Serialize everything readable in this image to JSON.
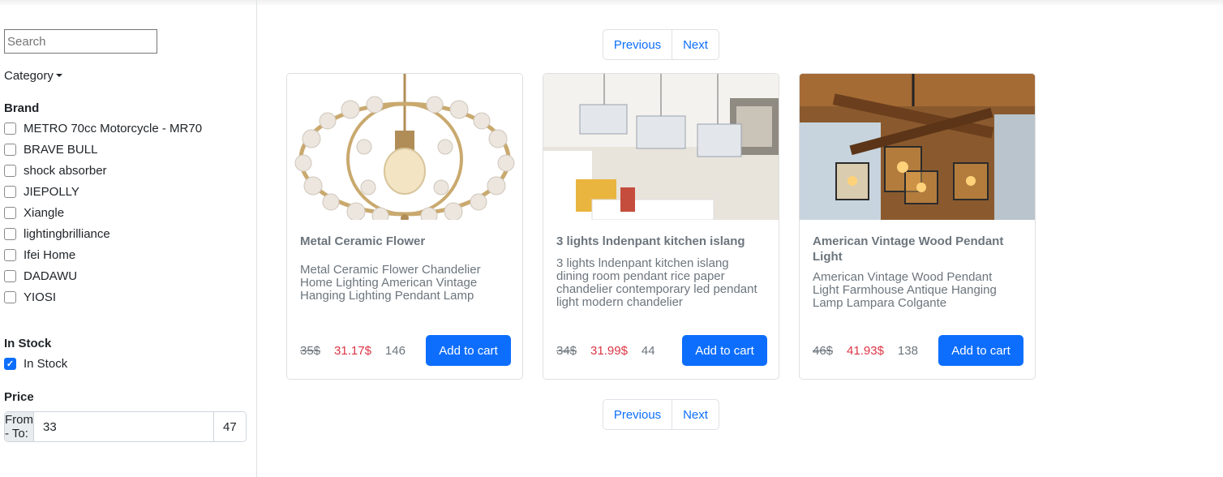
{
  "sidebar": {
    "search_placeholder": "Search",
    "category_label": "Category",
    "brand_title": "Brand",
    "brands": [
      {
        "label": "METRO 70cc Motorcycle - MR70",
        "checked": false
      },
      {
        "label": "BRAVE BULL",
        "checked": false
      },
      {
        "label": "shock absorber",
        "checked": false
      },
      {
        "label": "JIEPOLLY",
        "checked": false
      },
      {
        "label": "Xiangle",
        "checked": false
      },
      {
        "label": "lightingbrilliance",
        "checked": false
      },
      {
        "label": "Ifei Home",
        "checked": false
      },
      {
        "label": "DADAWU",
        "checked": false
      },
      {
        "label": "YIOSI",
        "checked": false
      }
    ],
    "stock_title": "In Stock",
    "stock_option": {
      "label": "In Stock",
      "checked": true
    },
    "price_title": "Price",
    "price_label": "From - To:",
    "price_from": "33",
    "price_to": "47"
  },
  "pagination": {
    "previous": "Previous",
    "next": "Next"
  },
  "products": [
    {
      "title": "Metal Ceramic Flower",
      "description": "Metal Ceramic Flower Chandelier Home Lighting American Vintage Hanging Lighting Pendant Lamp",
      "old_price": "35$",
      "new_price": "31.17$",
      "stock": "146",
      "button": "Add to cart"
    },
    {
      "title": "3 lights lndenpant kitchen islang",
      "description": "3 lights lndenpant kitchen islang dining room pendant rice paper chandelier contemporary led pendant light modern chandelier",
      "old_price": "34$",
      "new_price": "31.99$",
      "stock": "44",
      "button": "Add to cart"
    },
    {
      "title": "American Vintage Wood Pendant Light",
      "description": "American Vintage Wood Pendant Light Farmhouse Antique Hanging Lamp Lampara Colgante",
      "old_price": "46$",
      "new_price": "41.93$",
      "stock": "138",
      "button": "Add to cart"
    }
  ],
  "colors": {
    "primary": "#0d6efd",
    "sale_price": "#dc3545",
    "muted": "#6c757d"
  }
}
